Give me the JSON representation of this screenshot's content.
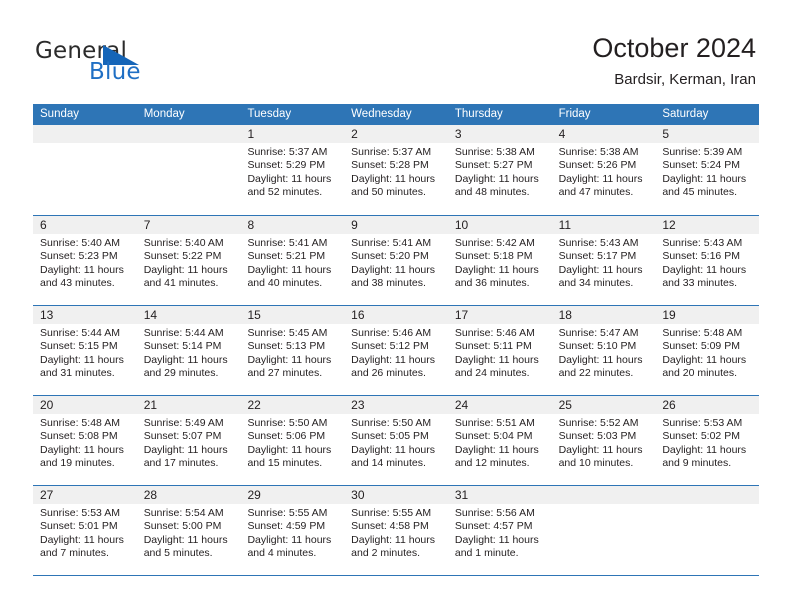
{
  "brand": {
    "name_part1": "General",
    "name_part2": "Blue",
    "triangle_color": "#1565b8",
    "blue_color": "#1f6fc4"
  },
  "header": {
    "title": "October 2024",
    "subtitle": "Bardsir, Kerman, Iran"
  },
  "theme": {
    "header_row_bg": "#2e75b6",
    "day_number_bg": "#f0f0f0",
    "grid_line": "#2e75b6",
    "text": "#231f20"
  },
  "calendar": {
    "day_names": [
      "Sunday",
      "Monday",
      "Tuesday",
      "Wednesday",
      "Thursday",
      "Friday",
      "Saturday"
    ],
    "weeks": [
      [
        {
          "empty": true
        },
        {
          "empty": true
        },
        {
          "day": "1",
          "sunrise": "Sunrise: 5:37 AM",
          "sunset": "Sunset: 5:29 PM",
          "daylight1": "Daylight: 11 hours",
          "daylight2": "and 52 minutes."
        },
        {
          "day": "2",
          "sunrise": "Sunrise: 5:37 AM",
          "sunset": "Sunset: 5:28 PM",
          "daylight1": "Daylight: 11 hours",
          "daylight2": "and 50 minutes."
        },
        {
          "day": "3",
          "sunrise": "Sunrise: 5:38 AM",
          "sunset": "Sunset: 5:27 PM",
          "daylight1": "Daylight: 11 hours",
          "daylight2": "and 48 minutes."
        },
        {
          "day": "4",
          "sunrise": "Sunrise: 5:38 AM",
          "sunset": "Sunset: 5:26 PM",
          "daylight1": "Daylight: 11 hours",
          "daylight2": "and 47 minutes."
        },
        {
          "day": "5",
          "sunrise": "Sunrise: 5:39 AM",
          "sunset": "Sunset: 5:24 PM",
          "daylight1": "Daylight: 11 hours",
          "daylight2": "and 45 minutes."
        }
      ],
      [
        {
          "day": "6",
          "sunrise": "Sunrise: 5:40 AM",
          "sunset": "Sunset: 5:23 PM",
          "daylight1": "Daylight: 11 hours",
          "daylight2": "and 43 minutes."
        },
        {
          "day": "7",
          "sunrise": "Sunrise: 5:40 AM",
          "sunset": "Sunset: 5:22 PM",
          "daylight1": "Daylight: 11 hours",
          "daylight2": "and 41 minutes."
        },
        {
          "day": "8",
          "sunrise": "Sunrise: 5:41 AM",
          "sunset": "Sunset: 5:21 PM",
          "daylight1": "Daylight: 11 hours",
          "daylight2": "and 40 minutes."
        },
        {
          "day": "9",
          "sunrise": "Sunrise: 5:41 AM",
          "sunset": "Sunset: 5:20 PM",
          "daylight1": "Daylight: 11 hours",
          "daylight2": "and 38 minutes."
        },
        {
          "day": "10",
          "sunrise": "Sunrise: 5:42 AM",
          "sunset": "Sunset: 5:18 PM",
          "daylight1": "Daylight: 11 hours",
          "daylight2": "and 36 minutes."
        },
        {
          "day": "11",
          "sunrise": "Sunrise: 5:43 AM",
          "sunset": "Sunset: 5:17 PM",
          "daylight1": "Daylight: 11 hours",
          "daylight2": "and 34 minutes."
        },
        {
          "day": "12",
          "sunrise": "Sunrise: 5:43 AM",
          "sunset": "Sunset: 5:16 PM",
          "daylight1": "Daylight: 11 hours",
          "daylight2": "and 33 minutes."
        }
      ],
      [
        {
          "day": "13",
          "sunrise": "Sunrise: 5:44 AM",
          "sunset": "Sunset: 5:15 PM",
          "daylight1": "Daylight: 11 hours",
          "daylight2": "and 31 minutes."
        },
        {
          "day": "14",
          "sunrise": "Sunrise: 5:44 AM",
          "sunset": "Sunset: 5:14 PM",
          "daylight1": "Daylight: 11 hours",
          "daylight2": "and 29 minutes."
        },
        {
          "day": "15",
          "sunrise": "Sunrise: 5:45 AM",
          "sunset": "Sunset: 5:13 PM",
          "daylight1": "Daylight: 11 hours",
          "daylight2": "and 27 minutes."
        },
        {
          "day": "16",
          "sunrise": "Sunrise: 5:46 AM",
          "sunset": "Sunset: 5:12 PM",
          "daylight1": "Daylight: 11 hours",
          "daylight2": "and 26 minutes."
        },
        {
          "day": "17",
          "sunrise": "Sunrise: 5:46 AM",
          "sunset": "Sunset: 5:11 PM",
          "daylight1": "Daylight: 11 hours",
          "daylight2": "and 24 minutes."
        },
        {
          "day": "18",
          "sunrise": "Sunrise: 5:47 AM",
          "sunset": "Sunset: 5:10 PM",
          "daylight1": "Daylight: 11 hours",
          "daylight2": "and 22 minutes."
        },
        {
          "day": "19",
          "sunrise": "Sunrise: 5:48 AM",
          "sunset": "Sunset: 5:09 PM",
          "daylight1": "Daylight: 11 hours",
          "daylight2": "and 20 minutes."
        }
      ],
      [
        {
          "day": "20",
          "sunrise": "Sunrise: 5:48 AM",
          "sunset": "Sunset: 5:08 PM",
          "daylight1": "Daylight: 11 hours",
          "daylight2": "and 19 minutes."
        },
        {
          "day": "21",
          "sunrise": "Sunrise: 5:49 AM",
          "sunset": "Sunset: 5:07 PM",
          "daylight1": "Daylight: 11 hours",
          "daylight2": "and 17 minutes."
        },
        {
          "day": "22",
          "sunrise": "Sunrise: 5:50 AM",
          "sunset": "Sunset: 5:06 PM",
          "daylight1": "Daylight: 11 hours",
          "daylight2": "and 15 minutes."
        },
        {
          "day": "23",
          "sunrise": "Sunrise: 5:50 AM",
          "sunset": "Sunset: 5:05 PM",
          "daylight1": "Daylight: 11 hours",
          "daylight2": "and 14 minutes."
        },
        {
          "day": "24",
          "sunrise": "Sunrise: 5:51 AM",
          "sunset": "Sunset: 5:04 PM",
          "daylight1": "Daylight: 11 hours",
          "daylight2": "and 12 minutes."
        },
        {
          "day": "25",
          "sunrise": "Sunrise: 5:52 AM",
          "sunset": "Sunset: 5:03 PM",
          "daylight1": "Daylight: 11 hours",
          "daylight2": "and 10 minutes."
        },
        {
          "day": "26",
          "sunrise": "Sunrise: 5:53 AM",
          "sunset": "Sunset: 5:02 PM",
          "daylight1": "Daylight: 11 hours",
          "daylight2": "and 9 minutes."
        }
      ],
      [
        {
          "day": "27",
          "sunrise": "Sunrise: 5:53 AM",
          "sunset": "Sunset: 5:01 PM",
          "daylight1": "Daylight: 11 hours",
          "daylight2": "and 7 minutes."
        },
        {
          "day": "28",
          "sunrise": "Sunrise: 5:54 AM",
          "sunset": "Sunset: 5:00 PM",
          "daylight1": "Daylight: 11 hours",
          "daylight2": "and 5 minutes."
        },
        {
          "day": "29",
          "sunrise": "Sunrise: 5:55 AM",
          "sunset": "Sunset: 4:59 PM",
          "daylight1": "Daylight: 11 hours",
          "daylight2": "and 4 minutes."
        },
        {
          "day": "30",
          "sunrise": "Sunrise: 5:55 AM",
          "sunset": "Sunset: 4:58 PM",
          "daylight1": "Daylight: 11 hours",
          "daylight2": "and 2 minutes."
        },
        {
          "day": "31",
          "sunrise": "Sunrise: 5:56 AM",
          "sunset": "Sunset: 4:57 PM",
          "daylight1": "Daylight: 11 hours",
          "daylight2": "and 1 minute."
        },
        {
          "empty": true
        },
        {
          "empty": true
        }
      ]
    ]
  }
}
